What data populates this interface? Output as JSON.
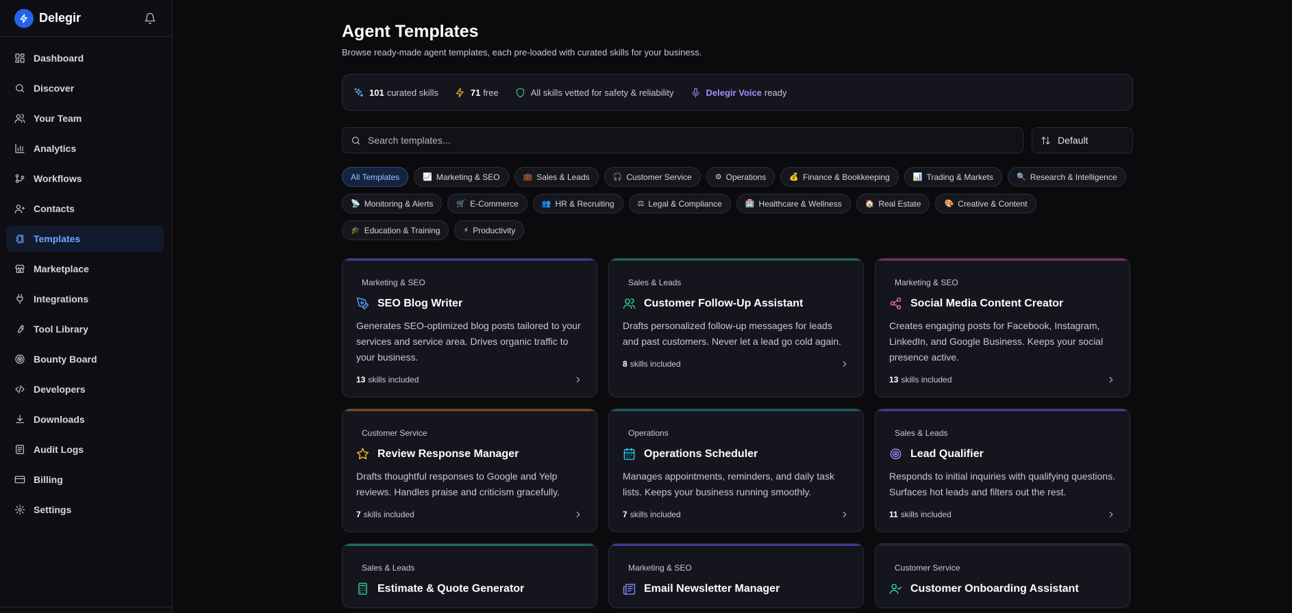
{
  "brand": {
    "name": "Delegir"
  },
  "nav": [
    {
      "label": "Dashboard",
      "icon": "dashboard-icon"
    },
    {
      "label": "Discover",
      "icon": "search-icon"
    },
    {
      "label": "Your Team",
      "icon": "users-icon"
    },
    {
      "label": "Analytics",
      "icon": "bar-chart-icon"
    },
    {
      "label": "Workflows",
      "icon": "workflow-icon"
    },
    {
      "label": "Contacts",
      "icon": "contacts-icon"
    },
    {
      "label": "Templates",
      "icon": "puzzle-icon",
      "active": true
    },
    {
      "label": "Marketplace",
      "icon": "store-icon"
    },
    {
      "label": "Integrations",
      "icon": "plug-icon"
    },
    {
      "label": "Tool Library",
      "icon": "wrench-icon"
    },
    {
      "label": "Bounty Board",
      "icon": "target-icon"
    },
    {
      "label": "Developers",
      "icon": "code-icon"
    },
    {
      "label": "Downloads",
      "icon": "download-icon"
    },
    {
      "label": "Audit Logs",
      "icon": "audit-icon"
    },
    {
      "label": "Billing",
      "icon": "card-icon"
    },
    {
      "label": "Settings",
      "icon": "gear-icon"
    }
  ],
  "page": {
    "title": "Agent Templates",
    "subtitle": "Browse ready-made agent templates, each pre-loaded with curated skills for your business."
  },
  "stats": {
    "skills_count": "101",
    "skills_label": "curated skills",
    "free_count": "71",
    "free_label": "free",
    "vetted": "All skills vetted for safety & reliability",
    "voice_name": "Delegir Voice",
    "voice_label": "ready"
  },
  "search": {
    "placeholder": "Search templates..."
  },
  "sort": {
    "label": "Default"
  },
  "chips": [
    {
      "label": "All Templates",
      "icon": "",
      "active": true
    },
    {
      "label": "Marketing & SEO",
      "icon": "📈"
    },
    {
      "label": "Sales & Leads",
      "icon": "💼"
    },
    {
      "label": "Customer Service",
      "icon": "🎧"
    },
    {
      "label": "Operations",
      "icon": "⚙"
    },
    {
      "label": "Finance & Bookkeeping",
      "icon": "💰"
    },
    {
      "label": "Trading & Markets",
      "icon": "📊"
    },
    {
      "label": "Research & Intelligence",
      "icon": "🔍"
    },
    {
      "label": "Monitoring & Alerts",
      "icon": "📡"
    },
    {
      "label": "E-Commerce",
      "icon": "🛒"
    },
    {
      "label": "HR & Recruiting",
      "icon": "👥"
    },
    {
      "label": "Legal & Compliance",
      "icon": "⚖"
    },
    {
      "label": "Healthcare & Wellness",
      "icon": "🏥"
    },
    {
      "label": "Real Estate",
      "icon": "🏠"
    },
    {
      "label": "Creative & Content",
      "icon": "🎨"
    },
    {
      "label": "Education & Training",
      "icon": "🎓"
    },
    {
      "label": "Productivity",
      "icon": "⚡"
    }
  ],
  "cards": [
    {
      "category": "Marketing & SEO",
      "title": "SEO Blog Writer",
      "icon": "pen-tool-icon",
      "color": "#60a5fa",
      "line": "#3b3f8f",
      "desc": "Generates SEO-optimized blog posts tailored to your services and service area. Drives organic traffic to your business.",
      "skills": "13",
      "skills_label": "skills included"
    },
    {
      "category": "Sales & Leads",
      "title": "Customer Follow-Up Assistant",
      "icon": "users-icon",
      "color": "#34d399",
      "line": "#1f6b58",
      "desc": "Drafts personalized follow-up messages for leads and past customers. Never let a lead go cold again.",
      "skills": "8",
      "skills_label": "skills included"
    },
    {
      "category": "Marketing & SEO",
      "title": "Social Media Content Creator",
      "icon": "share-icon",
      "color": "#f472b6",
      "line": "#7a2d5c",
      "desc": "Creates engaging posts for Facebook, Instagram, LinkedIn, and Google Business. Keeps your social presence active.",
      "skills": "13",
      "skills_label": "skills included"
    },
    {
      "category": "Customer Service",
      "title": "Review Response Manager",
      "icon": "star-icon",
      "color": "#fbbf24",
      "line": "#7a4a22",
      "desc": "Drafts thoughtful responses to Google and Yelp reviews. Handles praise and criticism gracefully.",
      "skills": "7",
      "skills_label": "skills included"
    },
    {
      "category": "Operations",
      "title": "Operations Scheduler",
      "icon": "calendar-icon",
      "color": "#22d3ee",
      "line": "#1f5a6b",
      "desc": "Manages appointments, reminders, and daily task lists. Keeps your business running smoothly.",
      "skills": "7",
      "skills_label": "skills included"
    },
    {
      "category": "Sales & Leads",
      "title": "Lead Qualifier",
      "icon": "target-icon",
      "color": "#a78bfa",
      "line": "#4b3a8f",
      "desc": "Responds to initial inquiries with qualifying questions. Surfaces hot leads and filters out the rest.",
      "skills": "11",
      "skills_label": "skills included"
    },
    {
      "category": "Sales & Leads",
      "title": "Estimate & Quote Generator",
      "icon": "calculator-icon",
      "color": "#34d399",
      "line": "#1f6b58",
      "desc": "",
      "skills": "",
      "skills_label": ""
    },
    {
      "category": "Marketing & SEO",
      "title": "Email Newsletter Manager",
      "icon": "newspaper-icon",
      "color": "#818cf8",
      "line": "#3b3f8f",
      "desc": "",
      "skills": "",
      "skills_label": ""
    },
    {
      "category": "Customer Service",
      "title": "Customer Onboarding Assistant",
      "icon": "user-check-icon",
      "color": "#2dd4bf",
      "line": "#23232b",
      "desc": "",
      "skills": "",
      "skills_label": ""
    }
  ]
}
